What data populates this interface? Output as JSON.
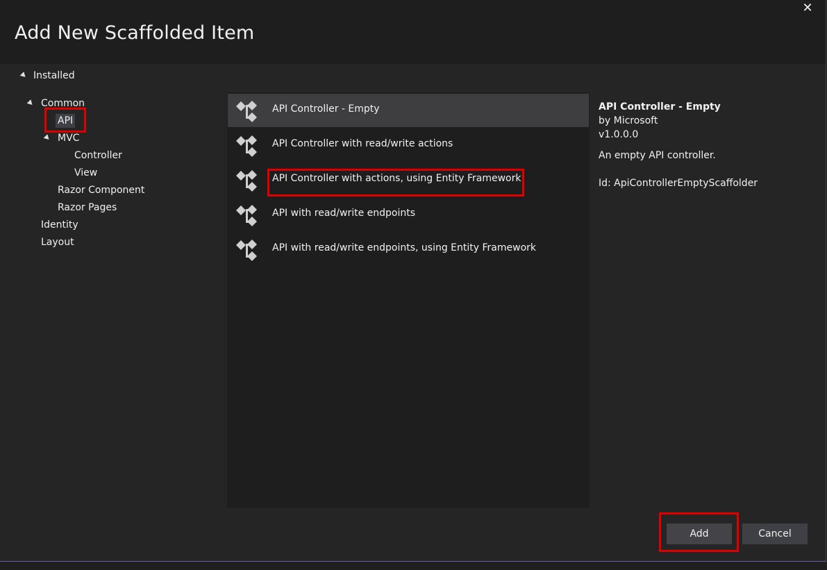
{
  "dialog": {
    "title": "Add New Scaffolded Item",
    "close_glyph": "✕"
  },
  "tree": {
    "installed": "Installed",
    "common": "Common",
    "api": "API",
    "mvc": "MVC",
    "controller": "Controller",
    "view": "View",
    "razor_component": "Razor Component",
    "razor_pages": "Razor Pages",
    "identity": "Identity",
    "layout": "Layout"
  },
  "templates": [
    {
      "label": "API Controller - Empty",
      "icon": "scaffold-icon"
    },
    {
      "label": "API Controller with read/write actions",
      "icon": "scaffold-icon"
    },
    {
      "label": "API Controller with actions, using Entity Framework",
      "icon": "scaffold-icon"
    },
    {
      "label": "API with read/write endpoints",
      "icon": "scaffold-icon"
    },
    {
      "label": "API with read/write endpoints, using Entity Framework",
      "icon": "scaffold-icon"
    }
  ],
  "details": {
    "name": "API Controller - Empty",
    "author": "by Microsoft",
    "version": "v1.0.0.0",
    "description": "An empty API controller.",
    "id": "Id: ApiControllerEmptyScaffolder"
  },
  "footer": {
    "add_label": "Add",
    "cancel_label": "Cancel"
  },
  "colors": {
    "highlight": "#e00000",
    "selected_row": "#3e3e40",
    "background": "#252526"
  }
}
